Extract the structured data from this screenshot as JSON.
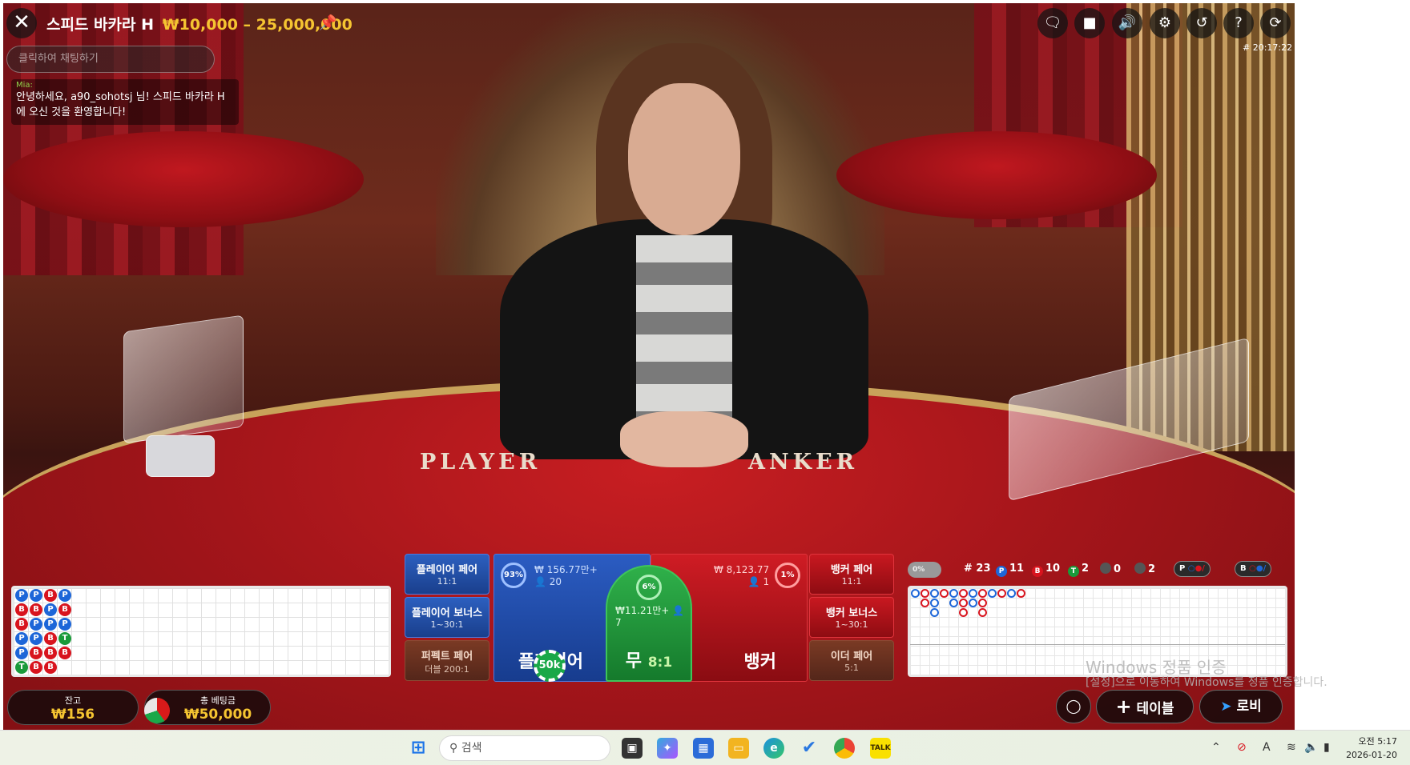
{
  "header": {
    "table_name": "스피드 바카라 H",
    "limits": "₩10,000 – 25,000,000",
    "chat_placeholder": "클릭하여 채팅하기",
    "round_time": "# 20:17:22"
  },
  "chat": {
    "user": "Mia:",
    "message": "안녕하세요, a90_sohotsj 님! 스피드 바카라 H에 오신 것을 환영합니다!"
  },
  "felt": {
    "player": "PLAYER",
    "banker": "ANKER"
  },
  "bead_road": [
    [
      "P",
      "B",
      "B",
      "P",
      "P",
      "T"
    ],
    [
      "P",
      "B",
      "P",
      "P",
      "B",
      "B"
    ],
    [
      "B",
      "P",
      "P",
      "B",
      "B",
      "B"
    ],
    [
      "P",
      "B",
      "P",
      "T",
      "B",
      ""
    ]
  ],
  "bets": {
    "player_pair": {
      "label": "플레이어 페어",
      "odds": "11:1"
    },
    "player_bonus": {
      "label": "플레이어 보너스",
      "odds": "1~30:1"
    },
    "perfect_pair": {
      "label": "퍼펙트 페어",
      "odds": "더블 200:1"
    },
    "banker_pair": {
      "label": "뱅커 페어",
      "odds": "11:1"
    },
    "banker_bonus": {
      "label": "뱅커 보너스",
      "odds": "1~30:1"
    },
    "either_pair": {
      "label": "이더 페어",
      "odds": "5:1"
    },
    "player": {
      "label": "플레이어",
      "percent": "93%",
      "amount": "₩ 156.77만+",
      "players": "20",
      "chip": "50k"
    },
    "tie": {
      "label": "무",
      "odds": "8:1",
      "percent": "6%",
      "amount": "₩11.21만+",
      "players": "7"
    },
    "banker": {
      "label": "뱅커",
      "percent": "1%",
      "amount": "₩ 8,123.77",
      "players": "1"
    }
  },
  "stats": {
    "toggle": "0%",
    "rounds": "# 23",
    "player_wins": "11",
    "banker_wins": "10",
    "ties": "2",
    "player_pairs": "0",
    "banker_pairs": "2",
    "predict_player": "P",
    "predict_banker": "B"
  },
  "wallet": {
    "balance_label": "잔고",
    "balance_value": "₩156",
    "total_bet_label": "총 베팅금",
    "total_bet_value": "₩50,000"
  },
  "actions": {
    "table": "테이블",
    "lobby": "로비"
  },
  "watermark": {
    "line1": "Windows 정품 인증",
    "line2": "[설정]으로 이동하여 Windows를 정품 인증합니다."
  },
  "taskbar": {
    "search_placeholder": "검색",
    "time": "오전 5:17",
    "date": "2026-01-20"
  },
  "colors": {
    "accent_gold": "#f5c431",
    "player_blue": "#1d66d8",
    "banker_red": "#d8141e",
    "tie_green": "#1a9a3a"
  }
}
